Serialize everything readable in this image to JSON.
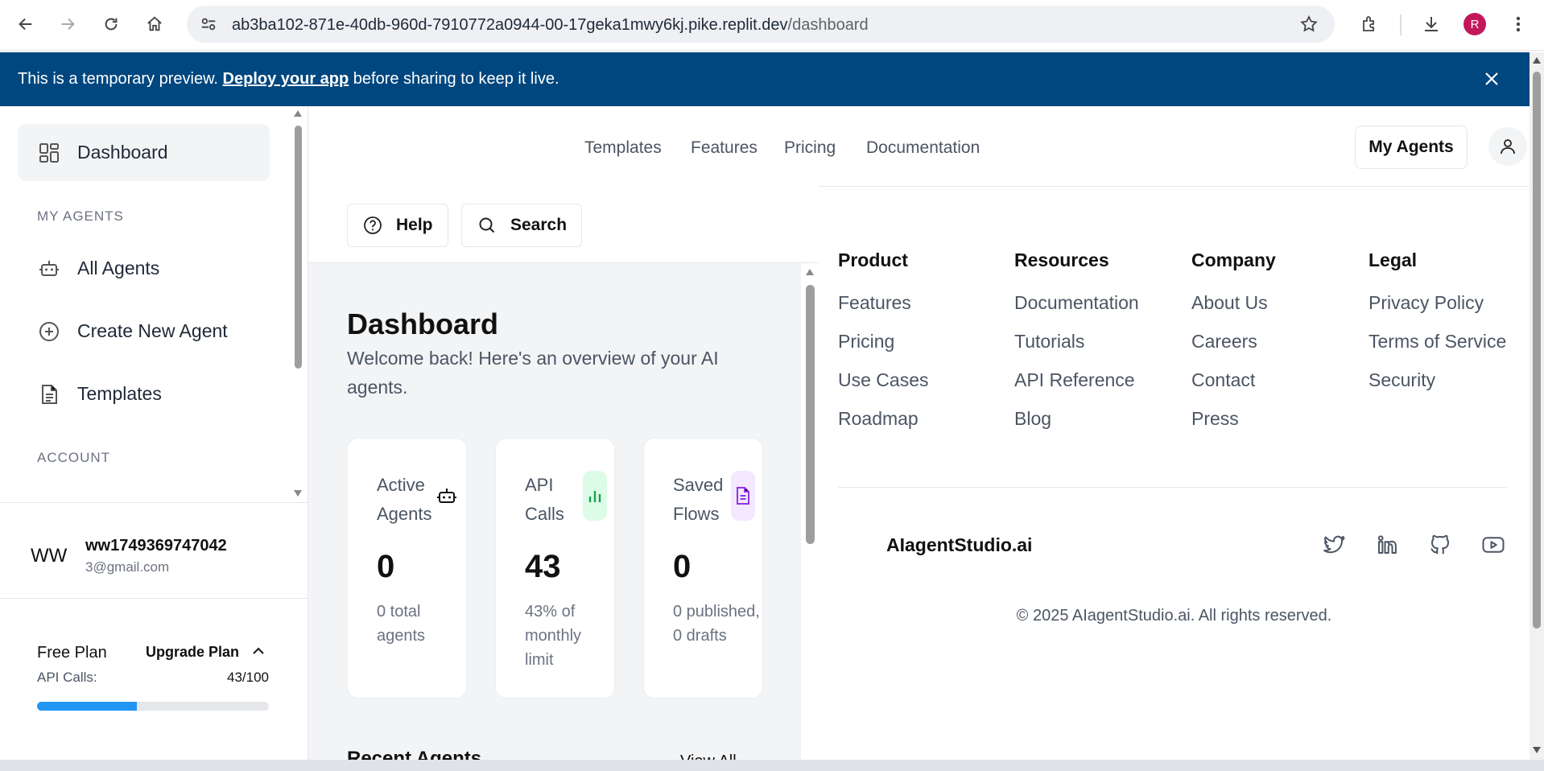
{
  "browser": {
    "url_main": "ab3ba102-871e-40db-960d-7910772a0944-00-17geka1mwy6kj.pike.replit.dev",
    "url_path": "/dashboard",
    "profile_initial": "R"
  },
  "banner": {
    "text_before": "This is a temporary preview. ",
    "link": "Deploy your app",
    "text_after": " before sharing to keep it live."
  },
  "sidebar": {
    "dashboard_label": "Dashboard",
    "section_my_agents": "MY AGENTS",
    "all_agents_label": "All Agents",
    "create_agent_label": "Create New Agent",
    "templates_label": "Templates",
    "section_account": "ACCOUNT"
  },
  "user": {
    "initials": "WW",
    "name": "ww1749369747042",
    "email": "3@gmail.com"
  },
  "plan": {
    "name": "Free Plan",
    "upgrade_label": "Upgrade Plan",
    "api_label": "API Calls:",
    "api_value": "43/100",
    "api_fraction": 0.43
  },
  "topnav": {
    "links": [
      "Templates",
      "Features",
      "Pricing",
      "Documentation"
    ],
    "my_agents_label": "My Agents"
  },
  "toolbar": {
    "help_label": "Help",
    "search_label": "Search"
  },
  "dashboard": {
    "title": "Dashboard",
    "subtitle": "Welcome back! Here's an overview of your AI agents.",
    "cards": [
      {
        "label": "Active Agents",
        "value": "0",
        "note": "0 total agents",
        "icon": "robot-icon"
      },
      {
        "label": "API Calls",
        "value": "43",
        "note": "43% of monthly limit",
        "icon": "bar-chart-icon",
        "accent": "#16a34a",
        "accent_bg": "#dcfce7"
      },
      {
        "label": "Saved Flows",
        "value": "0",
        "note": "0 published, 0 drafts",
        "icon": "document-icon",
        "accent": "#9333ea",
        "accent_bg": "#f3e8ff"
      }
    ],
    "recent_title": "Recent Agents",
    "view_all": "View All"
  },
  "footer": {
    "columns": [
      {
        "heading": "Product",
        "links": [
          "Features",
          "Pricing",
          "Use Cases",
          "Roadmap"
        ]
      },
      {
        "heading": "Resources",
        "links": [
          "Documentation",
          "Tutorials",
          "API Reference",
          "Blog"
        ]
      },
      {
        "heading": "Company",
        "links": [
          "About Us",
          "Careers",
          "Contact",
          "Press"
        ]
      },
      {
        "heading": "Legal",
        "links": [
          "Privacy Policy",
          "Terms of Service",
          "Security"
        ]
      }
    ],
    "brand": "AIagentStudio.ai",
    "copyright": "© 2025 AIagentStudio.ai. All rights reserved.",
    "socials": [
      "twitter-icon",
      "linkedin-icon",
      "github-icon",
      "youtube-icon"
    ]
  },
  "colors": {
    "banner_bg": "#00477f",
    "progress": "#2196f3"
  }
}
